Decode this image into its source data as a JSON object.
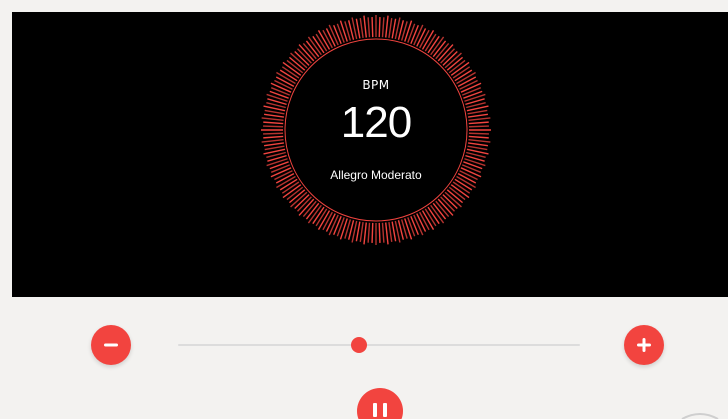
{
  "display": {
    "label": "BPM",
    "bpm": "120",
    "tempo_name": "Allegro Moderato"
  },
  "controls": {
    "minus_icon": "minus-icon",
    "plus_icon": "plus-icon",
    "pause_icon": "pause-icon",
    "slider_fraction": 0.45
  },
  "colors": {
    "accent": "#f2443f",
    "background": "#000000",
    "page": "#f3f2f0"
  }
}
